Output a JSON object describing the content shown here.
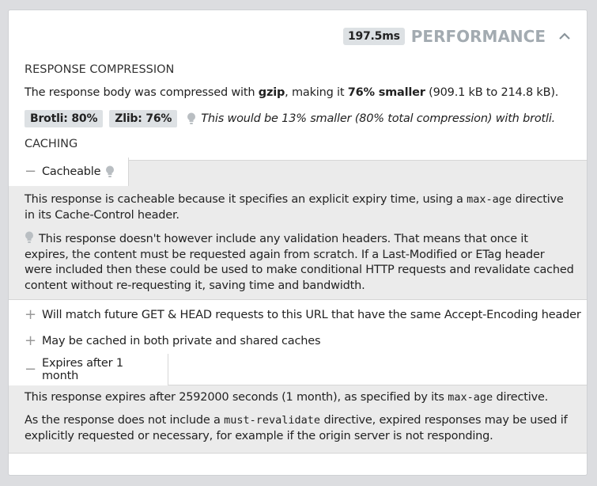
{
  "header": {
    "time": "197.5ms",
    "title": "PERFORMANCE",
    "collapse_icon": "chevron-up-icon"
  },
  "compression": {
    "section_title": "RESPONSE COMPRESSION",
    "sentence_prefix": "The response body was compressed with ",
    "algorithm": "gzip",
    "sentence_mid": ", making it ",
    "ratio_text": "76% smaller",
    "sentence_suffix": " (909.1 kB to 214.8 kB).",
    "chips": [
      "Brotli: 80%",
      "Zlib: 76%"
    ],
    "hint": "This would be 13% smaller (80% total compression) with brotli."
  },
  "caching": {
    "section_title": "CACHING",
    "cacheable": {
      "label": "Cacheable",
      "para1_a": "This response is cacheable because it specifies an explicit expiry time, using a ",
      "para1_code": "max-age",
      "para1_b": " directive in its Cache-Control header.",
      "para2": "This response doesn't however include any validation headers. That means that once it expires, the content must be requested again from scratch. If a Last-Modified or ETag header were included then these could be used to make conditional HTTP requests and revalidate cached content without re-requesting it, saving time and bandwidth."
    },
    "match_rule": "Will match future GET & HEAD requests to this URL that have the same Accept-Encoding header",
    "shared": "May be cached in both private and shared caches",
    "expires": {
      "label": "Expires after 1 month",
      "para1_a": "This response expires after 2592000 seconds (1 month), as specified by its ",
      "para1_code": "max-age",
      "para1_b": " directive.",
      "para2_a": "As the response does not include a ",
      "para2_code": "must-revalidate",
      "para2_b": " directive, expired responses may be used if explicitly requested or necessary, for example if the origin server is not responding."
    }
  },
  "colors": {
    "badge_bg": "#dde1e4",
    "title_grey": "#a3abb1",
    "panel_bg": "#ebebeb"
  }
}
